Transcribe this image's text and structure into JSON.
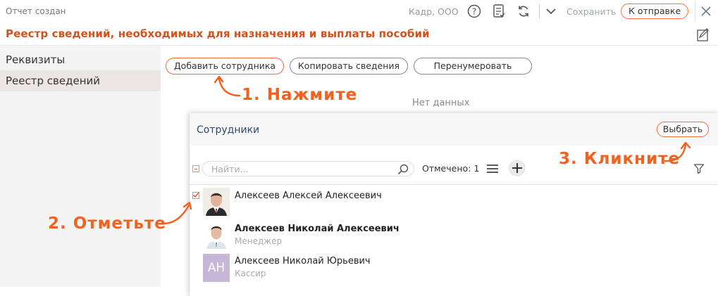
{
  "topbar": {
    "status": "Отчет создан",
    "org": "Кадр, ООО",
    "save_label": "Сохранить",
    "send_label": "К отправке"
  },
  "page": {
    "title": "Реестр сведений, необходимых для назначения и выплаты пособий"
  },
  "sidebar": {
    "items": [
      {
        "label": "Реквизиты"
      },
      {
        "label": "Реестр сведений"
      }
    ]
  },
  "toolbar": {
    "add_employee": "Добавить сотрудника",
    "copy_info": "Копировать сведения",
    "renumber": "Перенумеровать"
  },
  "main": {
    "no_data": "Нет данных"
  },
  "annotations": {
    "step1": "1. Нажмите",
    "step2": "2. Отметьте",
    "step3": "3. Кликните"
  },
  "employees_panel": {
    "title": "Сотрудники",
    "select_label": "Выбрать",
    "search_placeholder": "Найти...",
    "marked_count": "Отмечено: 1",
    "employees": [
      {
        "name": "Алексеев Алексей Алексеевич",
        "role": "",
        "checked": true
      },
      {
        "name": "Алексеев Николай Алексеевич",
        "role": "Менеджер",
        "checked": false
      },
      {
        "name": "Алексеев Николай Юрьевич",
        "role": "Кассир",
        "initials": "АН",
        "checked": false
      }
    ]
  },
  "colors": {
    "accent": "#f4611e",
    "title": "#d2511d",
    "panel_title": "#2d4a6e",
    "sidebar_bg": "#f4f4f4"
  },
  "icons": [
    "help-icon",
    "checklist-icon",
    "refresh-icon",
    "chevron-down-icon",
    "close-icon",
    "report-edit-icon",
    "search-icon",
    "menu-icon",
    "plus-icon",
    "filter-icon",
    "checkbox-icon",
    "minus-checkbox-icon"
  ]
}
